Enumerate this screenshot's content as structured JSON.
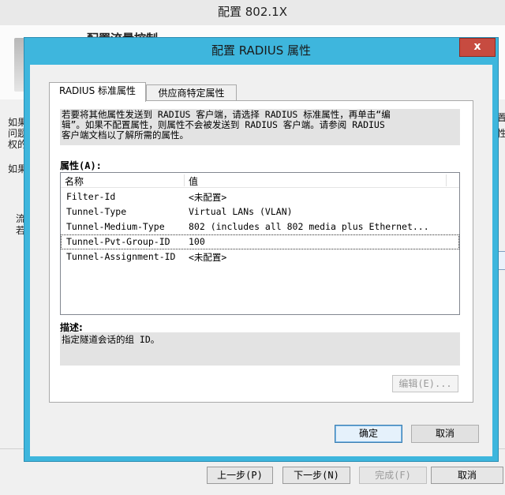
{
  "wizard": {
    "title": "配置 802.1X",
    "heading": "配置流量控制",
    "side_text_1": "如果",
    "side_text_2": "问题",
    "side_text_3": "权的",
    "side_text_4": "如果",
    "side_text_5": "流",
    "side_text_6": "若",
    "right_text_1": "置",
    "right_text_2": "性",
    "buttons": {
      "previous": "上一步(P)",
      "next": "下一步(N)",
      "finish": "完成(F)",
      "cancel": "取消"
    }
  },
  "dialog": {
    "title": "配置 RADIUS 属性",
    "close_glyph": "x",
    "tabs": {
      "standard": "RADIUS 标准属性",
      "vendor": "供应商特定属性"
    },
    "intro_line_1": "若要将其他属性发送到 RADIUS 客户端，请选择 RADIUS 标准属性，再单击“编",
    "intro_line_2": "辑”。如果不配置属性，则属性不会被发送到 RADIUS 客户端。请参阅 RADIUS",
    "intro_line_3": "客户端文档以了解所需的属性。",
    "attributes_label": "属性(A):",
    "columns": {
      "name": "名称",
      "value": "值"
    },
    "rows": [
      {
        "name": "Filter-Id",
        "value": "<未配置>"
      },
      {
        "name": "Tunnel-Type",
        "value": "Virtual LANs (VLAN)"
      },
      {
        "name": "Tunnel-Medium-Type",
        "value": "802 (includes all 802 media plus Ethernet..."
      },
      {
        "name": "Tunnel-Pvt-Group-ID",
        "value": "100"
      },
      {
        "name": "Tunnel-Assignment-ID",
        "value": "<未配置>"
      }
    ],
    "selected_row": 3,
    "description_label": "描述:",
    "description": "指定隧道会话的组 ID。",
    "edit_button": "编辑(E)...",
    "ok_button": "确定",
    "cancel_button": "取消"
  }
}
